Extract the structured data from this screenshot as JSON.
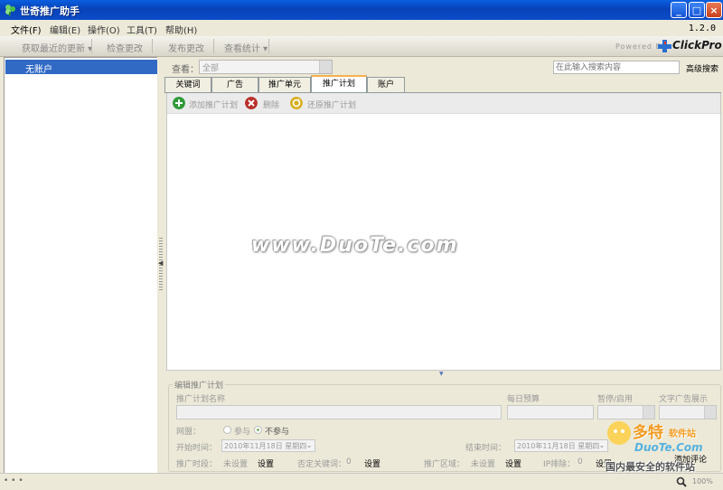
{
  "window": {
    "title": "世奇推广助手",
    "version": "1.2.0"
  },
  "menu": [
    "文件(F)",
    "编辑(E)",
    "操作(O)",
    "工具(T)",
    "帮助(H)"
  ],
  "toolbar": {
    "get_updates": "获取最近的更新 ▾",
    "check_changes": "检查更改",
    "publish_changes": "发布更改",
    "view_stats": "查看统计 ▾",
    "powered_by": "Powered By",
    "brand": "ClickPro"
  },
  "left_panel": {
    "account": "无账户"
  },
  "view": {
    "label": "查看：",
    "selected": "全部"
  },
  "search": {
    "placeholder": "在此输入搜索内容",
    "advanced": "高级搜索"
  },
  "tabs": [
    "关键词",
    "广告",
    "推广单元",
    "推广计划",
    "账户"
  ],
  "active_tab": "推广计划",
  "actions": {
    "add": "添加推广计划",
    "delete": "删除",
    "restore": "还原推广计划"
  },
  "watermark": "www.DuoTe.com",
  "edit": {
    "group_title": "编辑推广计划",
    "name_label": "推广计划名称",
    "budget_label": "每日预算",
    "pause_label": "暂停/启用",
    "text_ad_label": "文字广告展示",
    "network_label": "网盟：",
    "join": "参与",
    "not_join": "不参与",
    "start_label": "开始时间：",
    "start_value": "2010年11月18日 星期四",
    "end_label": "结束时间：",
    "end_value": "2010年11月18日 星期四",
    "schedule_label": "推广时段：",
    "schedule_value": "未设置",
    "set1": "设置",
    "neg_kw_label": "否定关键词：",
    "neg_kw_value": "0",
    "set2": "设置",
    "region_label": "推广区域：",
    "region_value": "未设置",
    "set3": "设置",
    "ip_label": "IP排除：",
    "ip_value": "0",
    "set4": "设置",
    "add_comment": "添加评论"
  },
  "status": {
    "left": "• • •",
    "zoom": "100%"
  },
  "site": {
    "name": "多特",
    "sub": "软件站",
    "domain": "DuoTe.Com",
    "slogan": "国内最安全的软件站"
  },
  "colors": {
    "titlebar": "#0842b8",
    "selection": "#316ac5",
    "active_tab_accent": "#f4b14d",
    "add_icon": "#2f9a3a",
    "delete_icon": "#b8302a",
    "restore_icon": "#d8b020"
  },
  "icons": {
    "app": "clover-icon",
    "add": "plus-circle-icon",
    "delete": "x-circle-icon",
    "restore": "restore-circle-icon",
    "zoom": "magnifier-icon"
  }
}
